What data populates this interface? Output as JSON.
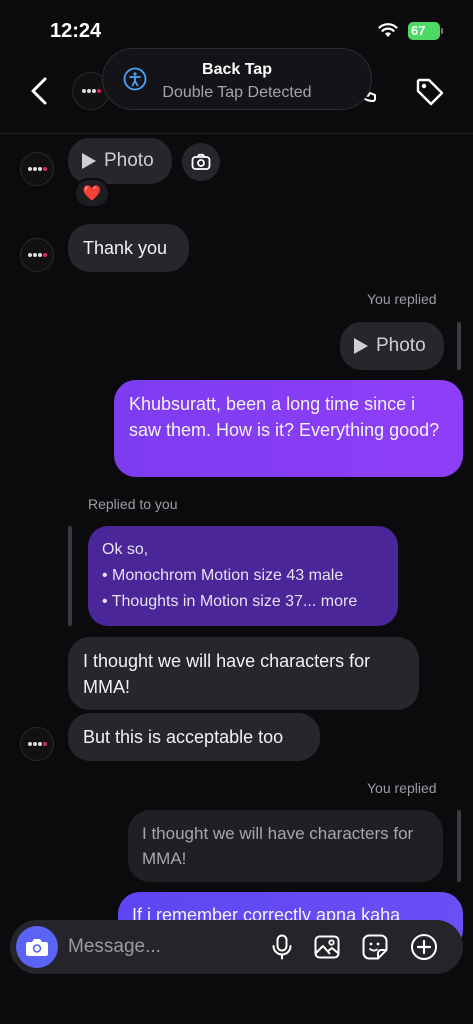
{
  "status_bar": {
    "time": "12:24",
    "battery": "67"
  },
  "toast": {
    "title": "Back Tap",
    "subtitle": "Double Tap Detected",
    "icon": "accessibility-icon"
  },
  "header": {
    "back_icon": "chevron-left-icon",
    "call_icon": "phone-icon",
    "tag_icon": "tag-icon"
  },
  "messages": {
    "photo1": "Photo",
    "reaction": "❤️",
    "thank_you": "Thank you",
    "you_replied_1": "You replied",
    "photo2": "Photo",
    "sent_1": "Khubsuratt, been a long time since i saw them. How is it? Everything good?",
    "replied_to_you": "Replied to you",
    "quoted_ok": "Ok so,",
    "quoted_line1": "• Monochrom Motion size 43 male",
    "quoted_line2": "• Thoughts in Motion size 37... more",
    "received_mma": "I thought we will have characters for MMA!",
    "received_acceptable": "But this is acceptable too",
    "you_replied_2": "You replied",
    "quoted_mma": "I thought we will have characters for MMA!",
    "sent_partial": "If i remember correctly apna kaha"
  },
  "composer": {
    "placeholder": "Message..."
  },
  "colors": {
    "accent_purple": "#8f3ef7",
    "camera_blue": "#5b63f5",
    "bubble_gray": "#26272b"
  }
}
